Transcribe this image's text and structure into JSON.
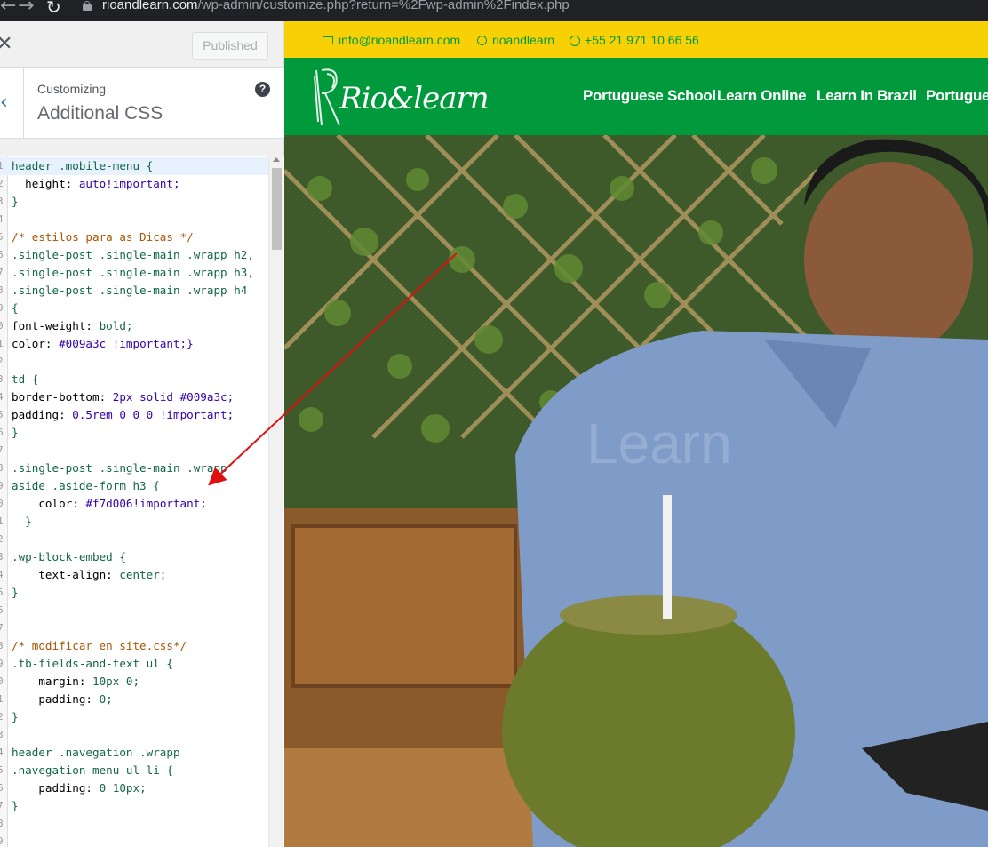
{
  "browser": {
    "url_host": "rioandlearn.com",
    "url_path": "/wp-admin/customize.php?return=%2Fwp-admin%2Findex.php"
  },
  "customizer": {
    "publish_label": "Published",
    "breadcrumb": "Customizing",
    "section_title": "Additional CSS",
    "help_icon_glyph": "?"
  },
  "editor": {
    "lines": [
      {
        "n": "1",
        "html": "header .mobile-menu {"
      },
      {
        "n": "2",
        "html": "  height: auto!important;"
      },
      {
        "n": "3",
        "html": "}"
      },
      {
        "n": "4",
        "html": ""
      },
      {
        "n": "5",
        "html": "/* estilos para as Dicas */"
      },
      {
        "n": "6",
        "html": ".single-post .single-main .wrapp h2,"
      },
      {
        "n": "7",
        "html": ".single-post .single-main .wrapp h3,"
      },
      {
        "n": "8",
        "html": ".single-post .single-main .wrapp h4"
      },
      {
        "n": "9",
        "html": "{"
      },
      {
        "n": "0",
        "html": "font-weight: bold;"
      },
      {
        "n": "1",
        "html": "color: #009a3c !important;}"
      },
      {
        "n": "2",
        "html": ""
      },
      {
        "n": "3",
        "html": "td {"
      },
      {
        "n": "4",
        "html": "border-bottom: 2px solid #009a3c;"
      },
      {
        "n": "5",
        "html": "padding: 0.5rem 0 0 0 !important;"
      },
      {
        "n": "6",
        "html": "}"
      },
      {
        "n": "7",
        "html": ""
      },
      {
        "n": "8",
        "html": ".single-post .single-main .wrapp"
      },
      {
        "n": "9",
        "html": "aside .aside-form h3 {"
      },
      {
        "n": "0",
        "html": "    color: #f7d006!important;"
      },
      {
        "n": "1",
        "html": "  }"
      },
      {
        "n": "2",
        "html": ""
      },
      {
        "n": "3",
        "html": ".wp-block-embed {"
      },
      {
        "n": "4",
        "html": "    text-align: center;"
      },
      {
        "n": "5",
        "html": "}"
      },
      {
        "n": "6",
        "html": ""
      },
      {
        "n": "7",
        "html": ""
      },
      {
        "n": "8",
        "html": "/* modificar en site.css*/"
      },
      {
        "n": "9",
        "html": ".tb-fields-and-text ul {"
      },
      {
        "n": "0",
        "html": "    margin: 10px 0;"
      },
      {
        "n": "1",
        "html": "    padding: 0;"
      },
      {
        "n": "2",
        "html": "}"
      },
      {
        "n": "3",
        "html": ""
      },
      {
        "n": "4",
        "html": "header .navegation .wrapp"
      },
      {
        "n": "5",
        "html": ".navegation-menu ul li {"
      },
      {
        "n": "6",
        "html": "    padding: 0 10px;"
      },
      {
        "n": "7",
        "html": "}"
      },
      {
        "n": "8",
        "html": ""
      },
      {
        "n": "9",
        "html": ""
      }
    ]
  },
  "site": {
    "topbar": {
      "email": "info@rioandlearn.com",
      "skype": "rioandlearn",
      "phone": "+55 21 971 10 66 56"
    },
    "logo_text": "Rio&learn",
    "nav": [
      "Portuguese School",
      "Learn Online",
      "Learn In Brazil",
      "Portugues"
    ],
    "watermark": "Learn",
    "colors": {
      "green": "#009a3c",
      "yellow": "#f7d006"
    }
  }
}
